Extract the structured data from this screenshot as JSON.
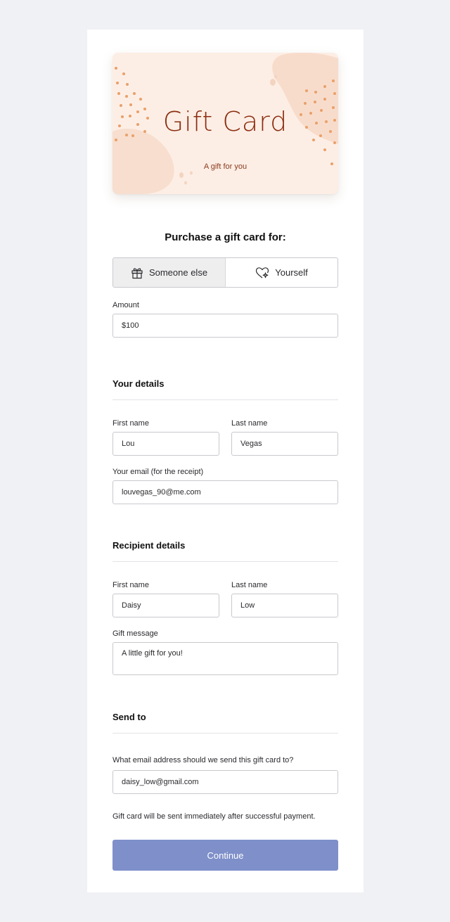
{
  "card": {
    "title": "Gift Card",
    "subtitle": "A gift for you"
  },
  "purchase": {
    "heading": "Purchase a gift card for:",
    "options": [
      {
        "label": "Someone else",
        "icon": "gift-icon",
        "selected": true
      },
      {
        "label": "Yourself",
        "icon": "heart-sparkle-icon",
        "selected": false
      }
    ]
  },
  "amount": {
    "label": "Amount",
    "value": "$100"
  },
  "your_details": {
    "title": "Your details",
    "first_name_label": "First name",
    "first_name": "Lou",
    "last_name_label": "Last name",
    "last_name": "Vegas",
    "email_label": "Your email (for the receipt)",
    "email": "louvegas_90@me.com"
  },
  "recipient": {
    "title": "Recipient details",
    "first_name_label": "First name",
    "first_name": "Daisy",
    "last_name_label": "Last name",
    "last_name": "Low",
    "message_label": "Gift message",
    "message": "A little gift for you!"
  },
  "send_to": {
    "title": "Send to",
    "email_label": "What email address should we send this gift card to?",
    "email": "daisy_low@gmail.com",
    "note": "Gift card will be sent immediately after successful payment."
  },
  "continue_label": "Continue",
  "colors": {
    "page_bg": "#f0f1f5",
    "card_bg": "#fdeee5",
    "card_title": "#8b2d10",
    "button": "#7e8fc9"
  }
}
